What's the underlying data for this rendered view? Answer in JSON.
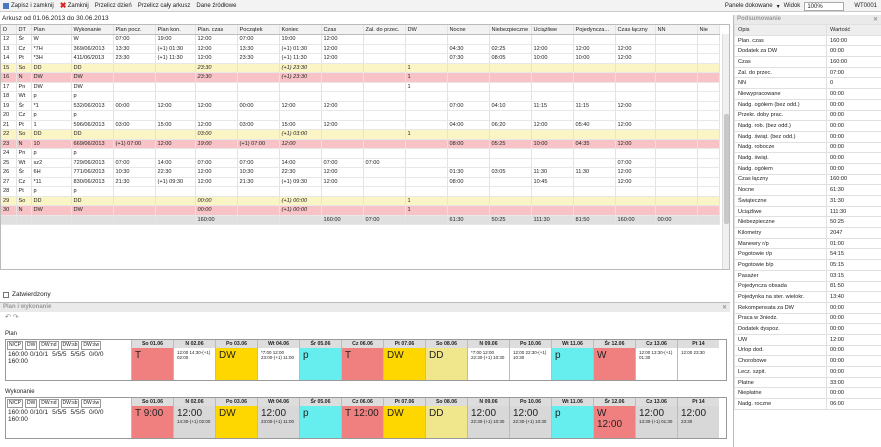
{
  "toolbar": {
    "save_close": "Zapisz i zamknij",
    "close": "Zamknij",
    "recalc_day": "Przelicz dzień",
    "recalc_sheet": "Przelicz cały arkusz",
    "source_data": "Dane źródłowe",
    "docking_panels": "Panele dokowane",
    "view": "Widok",
    "zoom": "100%",
    "user": "WT0001"
  },
  "sheet_caption": "Arkusz od 01.06.2013 do 30.06.2013",
  "grid": {
    "columns": [
      "D",
      "DT",
      "Plan",
      "Wykonanie",
      "Plan pocz.",
      "Plan kon.",
      "Plan. czas",
      "Początek",
      "Koniec",
      "Czas",
      "Zal. do przec.",
      "DW",
      "Nocne",
      "Niebezpieczne",
      "Uciążliwe",
      "Pojedyncza...",
      "Czas łączny",
      "NN",
      "Nie"
    ],
    "rows": [
      {
        "c": "",
        "v": [
          "12",
          "Śr",
          "W",
          "W",
          "07:00",
          "19:00",
          "12:00",
          "07:00",
          "19:00",
          "12:00",
          "",
          "",
          "",
          "",
          "",
          "",
          "",
          "",
          ""
        ]
      },
      {
        "c": "",
        "v": [
          "13",
          "Cz",
          "*7H",
          "369/06/2013",
          "13:30",
          "(+1) 01:30",
          "12:00",
          "13:30",
          "(+1) 01:30",
          "12:00",
          "",
          "",
          "04:30",
          "02:25",
          "12:00",
          "12:00",
          "12:00",
          "",
          ""
        ]
      },
      {
        "c": "",
        "v": [
          "14",
          "Pt",
          "*3H",
          "411/06/2013",
          "23:30",
          "(+1) 11:30",
          "12:00",
          "23:30",
          "(+1) 11:30",
          "12:00",
          "",
          "",
          "07:30",
          "08:05",
          "10:00",
          "10:00",
          "12:00",
          "",
          ""
        ]
      },
      {
        "c": "y",
        "v": [
          "15",
          "So",
          "DD",
          "DD",
          "",
          "",
          "23:30",
          "",
          "(+1) 23:30",
          "",
          "",
          "1",
          "",
          "",
          "",
          "",
          "",
          "",
          ""
        ]
      },
      {
        "c": "r",
        "v": [
          "16",
          "N",
          "DW",
          "DW",
          "",
          "",
          "23:30",
          "",
          "(+1) 23:30",
          "",
          "",
          "1",
          "",
          "",
          "",
          "",
          "",
          "",
          ""
        ]
      },
      {
        "c": "",
        "v": [
          "17",
          "Pn",
          "DW",
          "DW",
          "",
          "",
          "",
          "",
          "",
          "",
          "",
          "1",
          "",
          "",
          "",
          "",
          "",
          "",
          ""
        ]
      },
      {
        "c": "",
        "v": [
          "18",
          "Wt",
          "p",
          "p",
          "",
          "",
          "",
          "",
          "",
          "",
          "",
          "",
          "",
          "",
          "",
          "",
          "",
          "",
          ""
        ]
      },
      {
        "c": "",
        "v": [
          "19",
          "Śr",
          "*1",
          "532/06/2013",
          "00:00",
          "12:00",
          "12:00",
          "00:00",
          "12:00",
          "12:00",
          "",
          "",
          "07:00",
          "04:10",
          "11:15",
          "11:15",
          "12:00",
          "",
          ""
        ]
      },
      {
        "c": "",
        "v": [
          "20",
          "Cz",
          "p",
          "p",
          "",
          "",
          "",
          "",
          "",
          "",
          "",
          "",
          "",
          "",
          "",
          "",
          "",
          "",
          ""
        ]
      },
      {
        "c": "",
        "v": [
          "21",
          "Pt",
          "1",
          "596/06/2013",
          "03:00",
          "15:00",
          "12:00",
          "03:00",
          "15:00",
          "12:00",
          "",
          "",
          "04:00",
          "06:20",
          "12:00",
          "05:40",
          "12:00",
          "",
          ""
        ]
      },
      {
        "c": "y",
        "v": [
          "22",
          "So",
          "DD",
          "DD",
          "",
          "",
          "03:00",
          "",
          "(+1) 03:00",
          "",
          "",
          "1",
          "",
          "",
          "",
          "",
          "",
          "",
          ""
        ]
      },
      {
        "c": "r",
        "v": [
          "23",
          "N",
          "10",
          "669/06/2013",
          "(+1) 07:00",
          "12:00",
          "19:00",
          "(+1) 07:00",
          "12:00",
          "",
          "",
          "",
          "08:00",
          "05:25",
          "10:00",
          "04:35",
          "12:00",
          "",
          ""
        ]
      },
      {
        "c": "",
        "v": [
          "24",
          "Pn",
          "p",
          "p",
          "",
          "",
          "",
          "",
          "",
          "",
          "",
          "",
          "",
          "",
          "",
          "",
          "",
          "",
          ""
        ]
      },
      {
        "c": "",
        "v": [
          "25",
          "Wt",
          "sz2",
          "729/06/2013",
          "07:00",
          "14:00",
          "07:00",
          "07:00",
          "14:00",
          "07:00",
          "07:00",
          "",
          "",
          "",
          "",
          "",
          "07:00",
          "",
          ""
        ]
      },
      {
        "c": "",
        "v": [
          "26",
          "Śr",
          "6H",
          "771/06/2013",
          "10:30",
          "22:30",
          "12:00",
          "10:30",
          "22:30",
          "12:00",
          "",
          "",
          "01:30",
          "03:05",
          "11:30",
          "11:30",
          "12:00",
          "",
          ""
        ]
      },
      {
        "c": "",
        "v": [
          "27",
          "Cz",
          "*11",
          "830/06/2013",
          "21:30",
          "(+1) 09:30",
          "12:00",
          "21:30",
          "(+1) 09:30",
          "12:00",
          "",
          "",
          "08:00",
          "",
          "10:45",
          "",
          "12:00",
          "",
          ""
        ]
      },
      {
        "c": "",
        "v": [
          "28",
          "Pt",
          "p",
          "p",
          "",
          "",
          "",
          "",
          "",
          "",
          "",
          "",
          "",
          "",
          "",
          "",
          "",
          "",
          ""
        ]
      },
      {
        "c": "y",
        "v": [
          "29",
          "So",
          "DD",
          "DD",
          "",
          "",
          "00:00",
          "",
          "(+1) 00:00",
          "",
          "",
          "1",
          "",
          "",
          "",
          "",
          "",
          "",
          ""
        ]
      },
      {
        "c": "r",
        "v": [
          "30",
          "N",
          "DW",
          "DW",
          "",
          "",
          "00:00",
          "",
          "(+1) 00:00",
          "",
          "",
          "1",
          "",
          "",
          "",
          "",
          "",
          "",
          ""
        ]
      },
      {
        "c": "sum",
        "v": [
          "",
          "",
          "",
          "",
          "",
          "",
          "160:00",
          "",
          "",
          "160:00",
          "07:00",
          "",
          "61:30",
          "50:25",
          "111:30",
          "81:50",
          "160:00",
          "00:00",
          ""
        ]
      }
    ]
  },
  "confirm_label": "Zatwierdzony",
  "plan_panel": {
    "title": "Plan i wykonanie",
    "plan_label": "Plan",
    "exec_label": "Wykonanie",
    "sum_headers": [
      "N/CP",
      "DW",
      "DW:nd",
      "DW:sb",
      "DW:św"
    ],
    "plan_sum_values": [
      "160:00 160:00",
      "0/10/1",
      "5/5/5",
      "5/5/5",
      "0/0/0"
    ],
    "exec_sum_values": [
      "160:00 160:00",
      "0/10/1",
      "5/5/5",
      "5/5/5",
      "0/0/0"
    ],
    "days": [
      "So 01.06",
      "N 02.06",
      "Po 03.06",
      "Wt 04.06",
      "Śr 05.06",
      "Cz 06.06",
      "Pt 07.06",
      "So 08.06",
      "N 09.06",
      "Po 10.06",
      "Wt 11.06",
      "Śr 12.06",
      "Cz 13.06",
      "Pt 14"
    ],
    "plan_cells": [
      {
        "t": "T",
        "color": "#f08080",
        "small": ""
      },
      {
        "t": "",
        "color": "#ffffff",
        "small": "12:00 14:30-(+1) 02:00"
      },
      {
        "t": "DW",
        "color": "#ffd700",
        "small": ""
      },
      {
        "t": "",
        "color": "#ffffff",
        "small": "*7:00 12:00 23:00-(+1) 11:00"
      },
      {
        "t": "p",
        "color": "#66eeee",
        "small": ""
      },
      {
        "t": "T",
        "color": "#f08080",
        "small": ""
      },
      {
        "t": "DW",
        "color": "#ffd700",
        "small": ""
      },
      {
        "t": "DD",
        "color": "#f0e68c",
        "small": ""
      },
      {
        "t": "",
        "color": "#ffffff",
        "small": "*7:00 12:00 22:30-(+1) 10:30"
      },
      {
        "t": "",
        "color": "#ffffff",
        "small": "12:00 22:30-(+1) 10:30"
      },
      {
        "t": "p",
        "color": "#66eeee",
        "small": ""
      },
      {
        "t": "W",
        "color": "#f08080",
        "small": ""
      },
      {
        "t": "",
        "color": "#ffffff",
        "small": "12:00 13:30-(+1) 01:30"
      },
      {
        "t": "",
        "color": "#ffffff",
        "small": "12:00 23:30"
      }
    ],
    "exec_cells": [
      {
        "t": "T 9:00",
        "color": "#f08080",
        "small": ""
      },
      {
        "t": "12:00",
        "color": "#d8d8d8",
        "small": "14:30-(+1) 02:00"
      },
      {
        "t": "DW",
        "color": "#ffd700",
        "small": ""
      },
      {
        "t": "12:00",
        "color": "#d8d8d8",
        "small": "23:00-(+1) 11:00"
      },
      {
        "t": "p",
        "color": "#66eeee",
        "small": ""
      },
      {
        "t": "T 12:00",
        "color": "#f08080",
        "small": ""
      },
      {
        "t": "DW",
        "color": "#ffd700",
        "small": ""
      },
      {
        "t": "DD",
        "color": "#f0e68c",
        "small": ""
      },
      {
        "t": "12:00",
        "color": "#d8d8d8",
        "small": "22:30-(+1) 10:30"
      },
      {
        "t": "12:00",
        "color": "#d8d8d8",
        "small": "22:30-(+1) 10:30"
      },
      {
        "t": "p",
        "color": "#66eeee",
        "small": ""
      },
      {
        "t": "W 12:00",
        "color": "#f08080",
        "small": ""
      },
      {
        "t": "12:00",
        "color": "#d8d8d8",
        "small": "13:30-(+1) 01:30"
      },
      {
        "t": "12:00",
        "color": "#d8d8d8",
        "small": "23:30"
      }
    ]
  },
  "summary": {
    "title": "Podsumowanie",
    "head": [
      "Opis",
      "Wartość"
    ],
    "rows": [
      [
        "Plan. czas",
        "160:00"
      ],
      [
        "Dodatek za DW",
        "00:00"
      ],
      [
        "Czas",
        "160:00"
      ],
      [
        "Zal. do przec.",
        "07:00"
      ],
      [
        "NN",
        "0"
      ],
      [
        "Niewypracowane",
        "00:00"
      ],
      [
        "Nadg. ogółem (bez odd.)",
        "00:00"
      ],
      [
        "Przekr. doby prac.",
        "00:00"
      ],
      [
        "Nadg. rob. (bez odd.)",
        "00:00"
      ],
      [
        "Nadg. świąt. (bez odd.)",
        "00:00"
      ],
      [
        "Nadg. robocze",
        "00:00"
      ],
      [
        "Nadg. świąt.",
        "00:00"
      ],
      [
        "Nadg. ogółem",
        "00:00"
      ],
      [
        "Czas łączny",
        "160:00"
      ],
      [
        "Nocne",
        "61:30"
      ],
      [
        "Świąteczne",
        "31:30"
      ],
      [
        "Uciążliwe",
        "111:30"
      ],
      [
        "Niebezpieczne",
        "50:25"
      ],
      [
        "Kilometry",
        "2047"
      ],
      [
        "Manewry r/p",
        "01:00"
      ],
      [
        "Pogotowie r/p",
        "54:15"
      ],
      [
        "Pogotowie b/p",
        "05:15"
      ],
      [
        "Pasażer",
        "03:15"
      ],
      [
        "Pojedyncza obsada",
        "81:50"
      ],
      [
        "Pojedynka na ster. wielokr.",
        "13:40"
      ],
      [
        "Rekompensata za DW",
        "00:00"
      ],
      [
        "Praca w 3niedz.",
        "00:00"
      ],
      [
        "Dodatek dyspoz.",
        "00:00"
      ],
      [
        "UW",
        "12:00"
      ],
      [
        "Urlop dod.",
        "00:00"
      ],
      [
        "Chorobowe",
        "00:00"
      ],
      [
        "Lecz. szpit.",
        "00:00"
      ],
      [
        "Płatne",
        "33:00"
      ],
      [
        "Niepłatne",
        "00:00"
      ],
      [
        "Nadg. roczne",
        "06:00"
      ]
    ]
  }
}
